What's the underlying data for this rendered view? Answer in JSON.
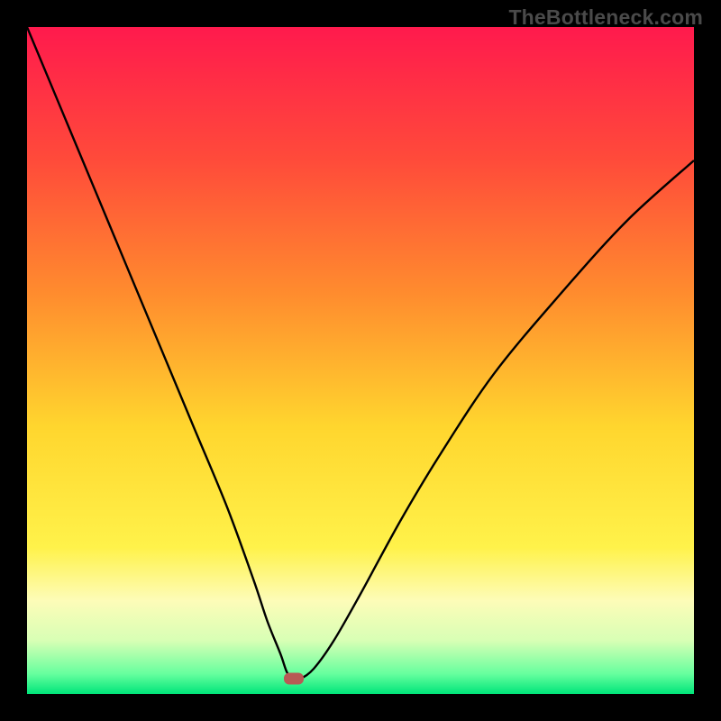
{
  "watermark": "TheBottleneck.com",
  "chart_data": {
    "type": "line",
    "title": "",
    "xlabel": "",
    "ylabel": "",
    "xlim": [
      0,
      100
    ],
    "ylim": [
      0,
      100
    ],
    "grid": false,
    "legend": false,
    "background_gradient": {
      "stops": [
        {
          "offset": 0,
          "color": "#ff1a4d"
        },
        {
          "offset": 20,
          "color": "#ff4b3a"
        },
        {
          "offset": 40,
          "color": "#ff8c2e"
        },
        {
          "offset": 60,
          "color": "#ffd62e"
        },
        {
          "offset": 78,
          "color": "#fff24a"
        },
        {
          "offset": 86,
          "color": "#fdfcb8"
        },
        {
          "offset": 92,
          "color": "#d8ffb5"
        },
        {
          "offset": 97,
          "color": "#66ff9e"
        },
        {
          "offset": 100,
          "color": "#00e57a"
        }
      ]
    },
    "marker": {
      "x": 40,
      "y": 2.3,
      "color": "#b85a55"
    },
    "series": [
      {
        "name": "curve",
        "color": "#000000",
        "x": [
          0,
          5,
          10,
          15,
          20,
          25,
          30,
          34,
          36,
          38,
          39,
          40,
          41,
          43,
          46,
          50,
          56,
          62,
          70,
          80,
          90,
          100
        ],
        "y": [
          100,
          88,
          76,
          64,
          52,
          40,
          28,
          17,
          11,
          6,
          3.2,
          2.3,
          2.3,
          3.8,
          8,
          15,
          26,
          36,
          48,
          60,
          71,
          80
        ]
      }
    ]
  }
}
